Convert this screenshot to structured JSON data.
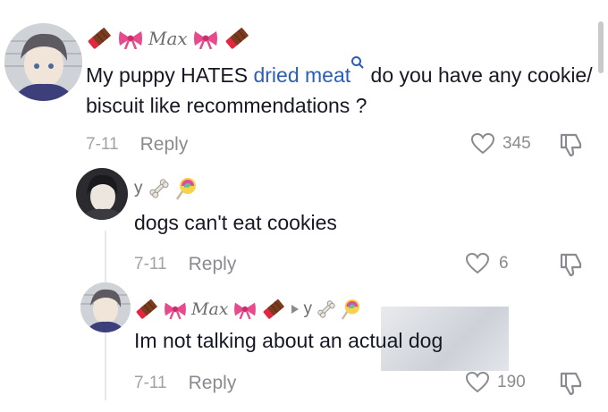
{
  "comments": [
    {
      "username": "Max",
      "text_before": "My puppy HATES ",
      "link_text": "dried meat",
      "text_after": " do you have any cookie/ biscuit like recommendations ?",
      "date": "7-11",
      "reply_label": "Reply",
      "likes": "345"
    },
    {
      "username": "y",
      "text": "dogs can't eat cookies",
      "date": "7-11",
      "reply_label": "Reply",
      "likes": "6"
    },
    {
      "username": "Max",
      "reply_to": "y",
      "text": "Im not talking about an actual dog",
      "date": "7-11",
      "reply_label": "Reply",
      "likes": "190"
    }
  ],
  "colors": {
    "text": "#161823",
    "link": "#2b5fb4",
    "muted": "#8a8b91",
    "chocolate": "#7a3b1f",
    "wrapper_red": "#e5253f",
    "bow_pink": "#e64b8c"
  },
  "icons": [
    "chocolate-icon",
    "bow-icon",
    "bone-icon",
    "lollipop-icon",
    "search-icon",
    "heart-icon",
    "dislike-icon",
    "reply-arrow-icon"
  ]
}
